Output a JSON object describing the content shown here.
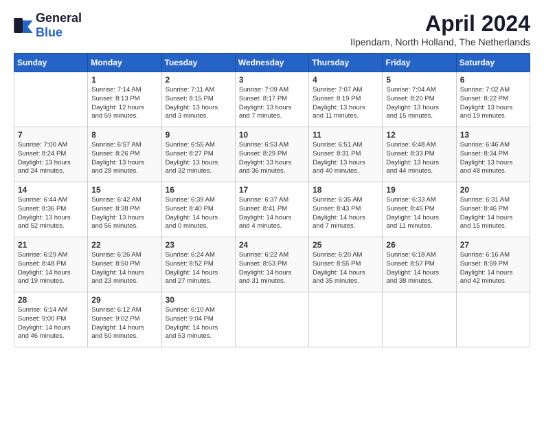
{
  "logo": {
    "general": "General",
    "blue": "Blue"
  },
  "title": "April 2024",
  "subtitle": "Ilpendam, North Holland, The Netherlands",
  "days_of_week": [
    "Sunday",
    "Monday",
    "Tuesday",
    "Wednesday",
    "Thursday",
    "Friday",
    "Saturday"
  ],
  "weeks": [
    [
      {
        "day": "",
        "content": ""
      },
      {
        "day": "1",
        "content": "Sunrise: 7:14 AM\nSunset: 8:13 PM\nDaylight: 12 hours\nand 59 minutes."
      },
      {
        "day": "2",
        "content": "Sunrise: 7:11 AM\nSunset: 8:15 PM\nDaylight: 13 hours\nand 3 minutes."
      },
      {
        "day": "3",
        "content": "Sunrise: 7:09 AM\nSunset: 8:17 PM\nDaylight: 13 hours\nand 7 minutes."
      },
      {
        "day": "4",
        "content": "Sunrise: 7:07 AM\nSunset: 8:19 PM\nDaylight: 13 hours\nand 11 minutes."
      },
      {
        "day": "5",
        "content": "Sunrise: 7:04 AM\nSunset: 8:20 PM\nDaylight: 13 hours\nand 15 minutes."
      },
      {
        "day": "6",
        "content": "Sunrise: 7:02 AM\nSunset: 8:22 PM\nDaylight: 13 hours\nand 19 minutes."
      }
    ],
    [
      {
        "day": "7",
        "content": "Sunrise: 7:00 AM\nSunset: 8:24 PM\nDaylight: 13 hours\nand 24 minutes."
      },
      {
        "day": "8",
        "content": "Sunrise: 6:57 AM\nSunset: 8:26 PM\nDaylight: 13 hours\nand 28 minutes."
      },
      {
        "day": "9",
        "content": "Sunrise: 6:55 AM\nSunset: 8:27 PM\nDaylight: 13 hours\nand 32 minutes."
      },
      {
        "day": "10",
        "content": "Sunrise: 6:53 AM\nSunset: 8:29 PM\nDaylight: 13 hours\nand 36 minutes."
      },
      {
        "day": "11",
        "content": "Sunrise: 6:51 AM\nSunset: 8:31 PM\nDaylight: 13 hours\nand 40 minutes."
      },
      {
        "day": "12",
        "content": "Sunrise: 6:48 AM\nSunset: 8:33 PM\nDaylight: 13 hours\nand 44 minutes."
      },
      {
        "day": "13",
        "content": "Sunrise: 6:46 AM\nSunset: 8:34 PM\nDaylight: 13 hours\nand 48 minutes."
      }
    ],
    [
      {
        "day": "14",
        "content": "Sunrise: 6:44 AM\nSunset: 8:36 PM\nDaylight: 13 hours\nand 52 minutes."
      },
      {
        "day": "15",
        "content": "Sunrise: 6:42 AM\nSunset: 8:38 PM\nDaylight: 13 hours\nand 56 minutes."
      },
      {
        "day": "16",
        "content": "Sunrise: 6:39 AM\nSunset: 8:40 PM\nDaylight: 14 hours\nand 0 minutes."
      },
      {
        "day": "17",
        "content": "Sunrise: 6:37 AM\nSunset: 8:41 PM\nDaylight: 14 hours\nand 4 minutes."
      },
      {
        "day": "18",
        "content": "Sunrise: 6:35 AM\nSunset: 8:43 PM\nDaylight: 14 hours\nand 7 minutes."
      },
      {
        "day": "19",
        "content": "Sunrise: 6:33 AM\nSunset: 8:45 PM\nDaylight: 14 hours\nand 11 minutes."
      },
      {
        "day": "20",
        "content": "Sunrise: 6:31 AM\nSunset: 8:46 PM\nDaylight: 14 hours\nand 15 minutes."
      }
    ],
    [
      {
        "day": "21",
        "content": "Sunrise: 6:29 AM\nSunset: 8:48 PM\nDaylight: 14 hours\nand 19 minutes."
      },
      {
        "day": "22",
        "content": "Sunrise: 6:26 AM\nSunset: 8:50 PM\nDaylight: 14 hours\nand 23 minutes."
      },
      {
        "day": "23",
        "content": "Sunrise: 6:24 AM\nSunset: 8:52 PM\nDaylight: 14 hours\nand 27 minutes."
      },
      {
        "day": "24",
        "content": "Sunrise: 6:22 AM\nSunset: 8:53 PM\nDaylight: 14 hours\nand 31 minutes."
      },
      {
        "day": "25",
        "content": "Sunrise: 6:20 AM\nSunset: 8:55 PM\nDaylight: 14 hours\nand 35 minutes."
      },
      {
        "day": "26",
        "content": "Sunrise: 6:18 AM\nSunset: 8:57 PM\nDaylight: 14 hours\nand 38 minutes."
      },
      {
        "day": "27",
        "content": "Sunrise: 6:16 AM\nSunset: 8:59 PM\nDaylight: 14 hours\nand 42 minutes."
      }
    ],
    [
      {
        "day": "28",
        "content": "Sunrise: 6:14 AM\nSunset: 9:00 PM\nDaylight: 14 hours\nand 46 minutes."
      },
      {
        "day": "29",
        "content": "Sunrise: 6:12 AM\nSunset: 9:02 PM\nDaylight: 14 hours\nand 50 minutes."
      },
      {
        "day": "30",
        "content": "Sunrise: 6:10 AM\nSunset: 9:04 PM\nDaylight: 14 hours\nand 53 minutes."
      },
      {
        "day": "",
        "content": ""
      },
      {
        "day": "",
        "content": ""
      },
      {
        "day": "",
        "content": ""
      },
      {
        "day": "",
        "content": ""
      }
    ]
  ]
}
